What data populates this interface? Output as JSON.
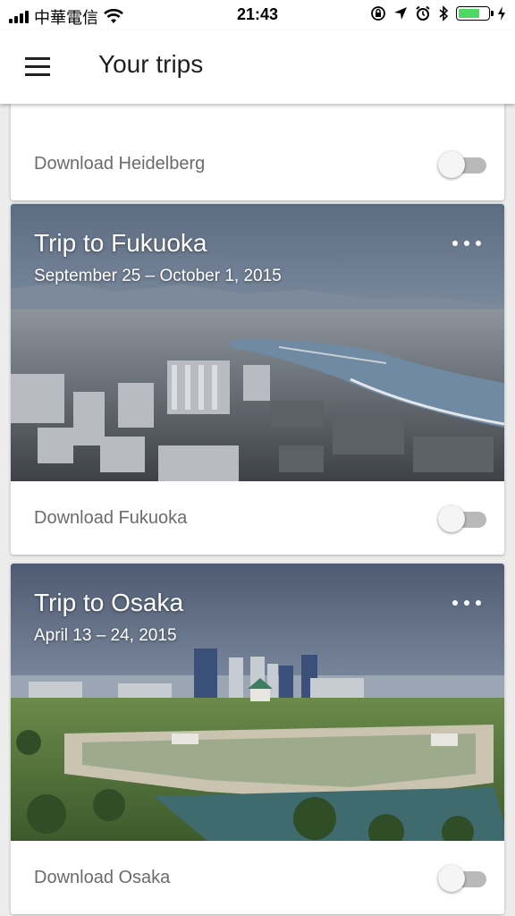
{
  "status_bar": {
    "carrier": "中華電信",
    "time": "21:43",
    "battery_level": 0.75,
    "icons": [
      "signal-icon",
      "wifi-icon",
      "rotation-lock-icon",
      "location-icon",
      "alarm-icon",
      "bluetooth-icon",
      "battery-icon",
      "charging-icon"
    ]
  },
  "app_bar": {
    "title": "Your trips",
    "menu_icon": "hamburger-menu-icon"
  },
  "trips": [
    {
      "download_label": "Download Heidelberg",
      "download_enabled": false
    },
    {
      "title": "Trip to Fukuoka",
      "dates": "September 25 – October 1, 2015",
      "download_label": "Download Fukuoka",
      "download_enabled": false
    },
    {
      "title": "Trip to Osaka",
      "dates": "April 13 – 24, 2015",
      "download_label": "Download Osaka",
      "download_enabled": false
    }
  ],
  "colors": {
    "background": "#ececec",
    "card": "#ffffff",
    "toggle_track": "#b9b9b9",
    "battery": "#4cd964"
  }
}
